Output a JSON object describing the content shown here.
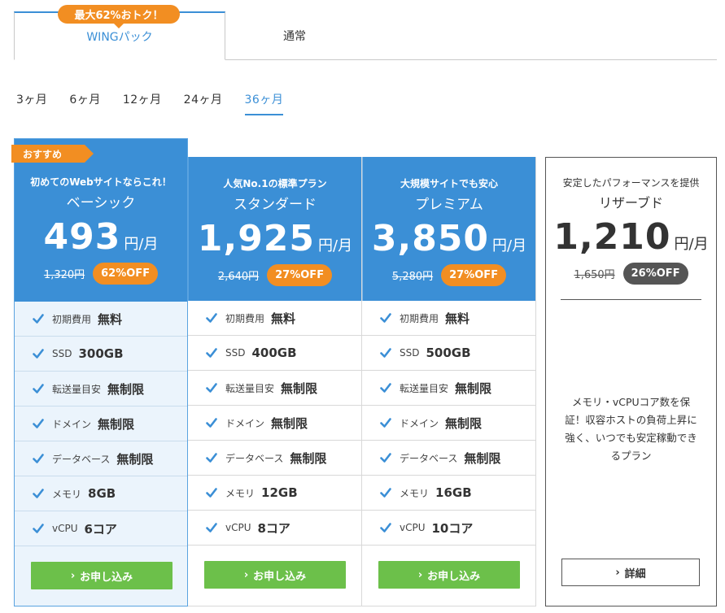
{
  "tabs": {
    "promo_badge": "最大62%おトク！",
    "active_label": "WINGパック",
    "normal_label": "通常"
  },
  "periods": {
    "items": [
      "3ヶ月",
      "6ヶ月",
      "12ヶ月",
      "24ヶ月",
      "36ヶ月"
    ],
    "selected": "36ヶ月"
  },
  "plans": {
    "basic": {
      "recommend_badge": "おすすめ",
      "tagline": "初めてのWebサイトならこれ！",
      "name": "ベーシック",
      "price": "493",
      "unit": "円/月",
      "old_price": "1,320円",
      "discount": "62%OFF",
      "features": [
        {
          "label": "初期費用",
          "value": "無料"
        },
        {
          "label": "SSD",
          "value": "300GB"
        },
        {
          "label": "転送量目安",
          "value": "無制限"
        },
        {
          "label": "ドメイン",
          "value": "無制限"
        },
        {
          "label": "データベース",
          "value": "無制限"
        },
        {
          "label": "メモリ",
          "value": "8GB"
        },
        {
          "label": "vCPU",
          "value": "6コア"
        }
      ],
      "button": "お申し込み"
    },
    "standard": {
      "tagline": "人気No.1の標準プラン",
      "name": "スタンダード",
      "price": "1,925",
      "unit": "円/月",
      "old_price": "2,640円",
      "discount": "27%OFF",
      "features": [
        {
          "label": "初期費用",
          "value": "無料"
        },
        {
          "label": "SSD",
          "value": "400GB"
        },
        {
          "label": "転送量目安",
          "value": "無制限"
        },
        {
          "label": "ドメイン",
          "value": "無制限"
        },
        {
          "label": "データベース",
          "value": "無制限"
        },
        {
          "label": "メモリ",
          "value": "12GB"
        },
        {
          "label": "vCPU",
          "value": "8コア"
        }
      ],
      "button": "お申し込み"
    },
    "premium": {
      "tagline": "大規模サイトでも安心",
      "name": "プレミアム",
      "price": "3,850",
      "unit": "円/月",
      "old_price": "5,280円",
      "discount": "27%OFF",
      "features": [
        {
          "label": "初期費用",
          "value": "無料"
        },
        {
          "label": "SSD",
          "value": "500GB"
        },
        {
          "label": "転送量目安",
          "value": "無制限"
        },
        {
          "label": "ドメイン",
          "value": "無制限"
        },
        {
          "label": "データベース",
          "value": "無制限"
        },
        {
          "label": "メモリ",
          "value": "16GB"
        },
        {
          "label": "vCPU",
          "value": "10コア"
        }
      ],
      "button": "お申し込み"
    },
    "reserved": {
      "tagline": "安定したパフォーマンスを提供",
      "name": "リザーブド",
      "price": "1,210",
      "unit": "円/月",
      "old_price": "1,650円",
      "discount": "26%OFF",
      "description": "メモリ・vCPUコア数を保証！収容ホストの負荷上昇に強く、いつでも安定稼動できるプラン",
      "button": "詳細"
    }
  },
  "colors": {
    "accent_blue": "#3b8fd6",
    "accent_orange": "#f28e22",
    "button_green": "#6cc04a",
    "reserved_gray": "#555555"
  }
}
